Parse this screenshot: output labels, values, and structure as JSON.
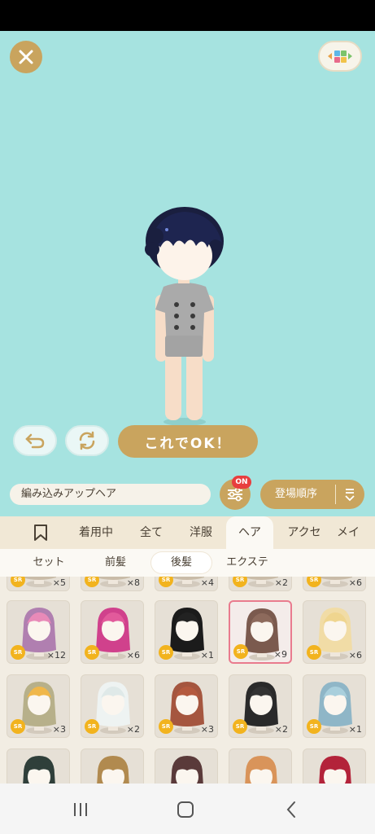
{
  "stage": {
    "background": "#a6e3e0",
    "close_icon": "close-icon",
    "layout_icon": "color-grid-icon",
    "undo_icon": "undo-icon",
    "rotate_icon": "rotate-icon",
    "ok_label": "これでOK！"
  },
  "toolbar": {
    "item_name": "編み込みアップヘア",
    "filter_icon": "filter-sliders-icon",
    "filter_badge": "ON",
    "sort_label": "登場順序",
    "sort_icon": "sort-order-icon"
  },
  "tabs": [
    {
      "label": "bookmark",
      "icon": "bookmark-icon"
    },
    {
      "label": "着用中"
    },
    {
      "label": "全て"
    },
    {
      "label": "洋服"
    },
    {
      "label": "ヘア",
      "active": true
    },
    {
      "label": "アクセ"
    },
    {
      "label": "メイ"
    }
  ],
  "subtabs": [
    {
      "label": "セット"
    },
    {
      "label": "前髪"
    },
    {
      "label": "後髪",
      "active": true
    },
    {
      "label": "エクステ"
    }
  ],
  "items": {
    "row0": [
      {
        "rarity": "SR",
        "count": "×5"
      },
      {
        "rarity": "SR",
        "count": "×8"
      },
      {
        "rarity": "SR",
        "count": "×4"
      },
      {
        "rarity": "SR",
        "count": "×2"
      },
      {
        "rarity": "SR",
        "count": "×6"
      }
    ],
    "row1": [
      {
        "rarity": "SR",
        "count": "×12",
        "hair": "#b07fb0",
        "accent": "#e88ab8"
      },
      {
        "rarity": "SR",
        "count": "×6",
        "hair": "#d0418c",
        "accent": "#e25a9b"
      },
      {
        "rarity": "SR",
        "count": "×1",
        "hair": "#1b1b1b",
        "accent": "#222"
      },
      {
        "rarity": "SR",
        "count": "×9",
        "hair": "#7b5a4e",
        "accent": "#8d6a5c",
        "selected": true
      },
      {
        "rarity": "SR",
        "count": "×6",
        "hair": "#f1dca6",
        "accent": "#efd58f"
      }
    ],
    "row2": [
      {
        "rarity": "SR",
        "count": "×3",
        "hair": "#b7b08a",
        "accent": "#f0b74a"
      },
      {
        "rarity": "SR",
        "count": "×2",
        "hair": "#eef3f2",
        "accent": "#dfe9e8"
      },
      {
        "rarity": "SR",
        "count": "×3",
        "hair": "#a5563f",
        "accent": "#b45a3f"
      },
      {
        "rarity": "SR",
        "count": "×2",
        "hair": "#2a2a2a",
        "accent": "#333"
      },
      {
        "rarity": "SR",
        "count": "×1",
        "hair": "#8fb6c7",
        "accent": "#a9cfdc"
      }
    ],
    "row3": [
      {
        "hair": "#2f3f3a"
      },
      {
        "hair": "#b18a4f"
      },
      {
        "hair": "#5a3a3a"
      },
      {
        "hair": "#d9945a"
      },
      {
        "hair": "#b3233a"
      }
    ]
  },
  "navbar": {
    "recent_icon": "recent-apps-icon",
    "home_icon": "home-icon",
    "back_icon": "back-icon"
  }
}
